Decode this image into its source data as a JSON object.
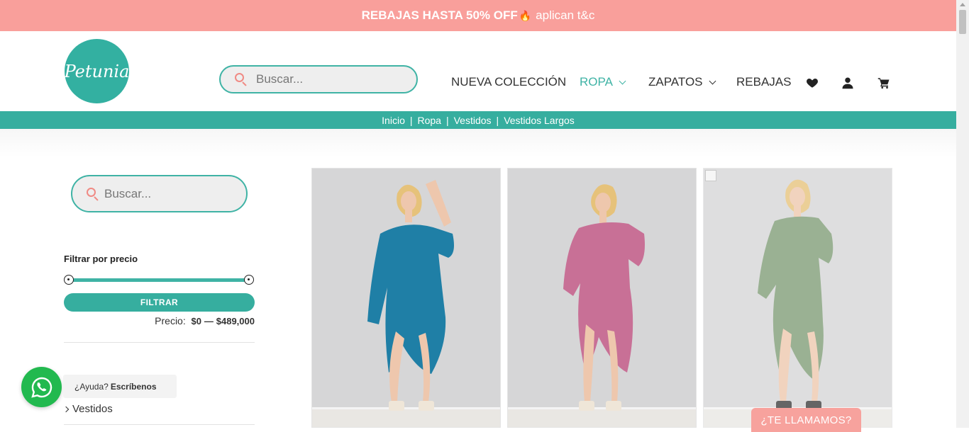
{
  "promo": {
    "bold_text": "REBAJAS HASTA 50% OFF",
    "rest_text": "aplican t&c",
    "icon": "flame-icon"
  },
  "header": {
    "logo_text": "Petunia",
    "search_placeholder": "Buscar...",
    "nav": [
      {
        "label": "NUEVA COLECCIÓN"
      },
      {
        "label": "ROPA",
        "active": true
      },
      {
        "label": "ZAPATOS"
      },
      {
        "label": "REBAJAS"
      }
    ],
    "icons": [
      "heart-icon",
      "user-icon",
      "cart-icon"
    ]
  },
  "breadcrumb": [
    "Inicio",
    "Ropa",
    "Vestidos",
    "Vestidos Largos"
  ],
  "sidebar": {
    "search_placeholder": "Buscar...",
    "filter_title": "Filtrar por precio",
    "filter_button": "FILTRAR",
    "price_label": "Precio:",
    "price_min": "$0",
    "price_sep": "—",
    "price_max": "$489,000",
    "category_link": "Vestidos"
  },
  "whatsapp": {
    "question": "¿Ayuda?",
    "action": "Escríbenos"
  },
  "products": [
    {
      "dress_color": "#1f7fa6"
    },
    {
      "dress_color": "#c87096"
    },
    {
      "dress_color": "#7e9c76"
    }
  ],
  "call_button": "¿TE LLAMAMOS?",
  "colors": {
    "teal": "#36ae9f",
    "salmon": "#f99f9b",
    "whatsapp": "#22b94f"
  }
}
